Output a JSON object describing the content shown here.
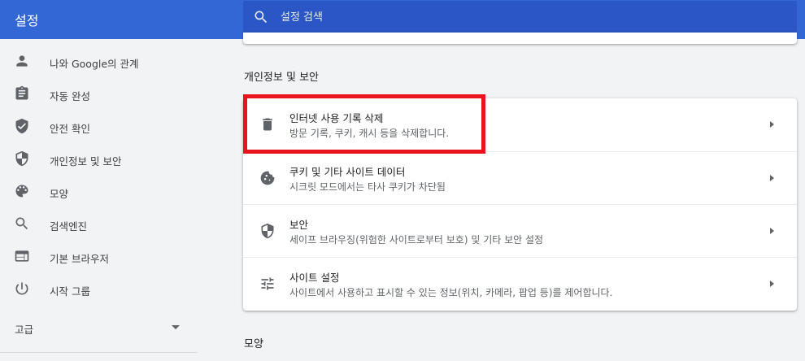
{
  "header": {
    "title": "설정",
    "search_placeholder": "설정 검색",
    "search_value": ""
  },
  "sidebar": {
    "items": [
      {
        "label": "나와 Google의 관계",
        "icon": "person-icon"
      },
      {
        "label": "자동 완성",
        "icon": "clipboard-icon"
      },
      {
        "label": "안전 확인",
        "icon": "shield-check-icon"
      },
      {
        "label": "개인정보 및 보안",
        "icon": "shield-icon"
      },
      {
        "label": "모양",
        "icon": "palette-icon"
      },
      {
        "label": "검색엔진",
        "icon": "search-icon"
      },
      {
        "label": "기본 브라우저",
        "icon": "browser-icon"
      },
      {
        "label": "시작 그룹",
        "icon": "power-icon"
      }
    ],
    "advanced_label": "고급"
  },
  "main": {
    "section_privacy": "개인정보 및 보안",
    "rows": [
      {
        "title": "인터넷 사용 기록 삭제",
        "sub": "방문 기록, 쿠키, 캐시 등을 삭제합니다.",
        "icon": "trash-icon"
      },
      {
        "title": "쿠키 및 기타 사이트 데이터",
        "sub": "시크릿 모드에서는 타사 쿠키가 차단됨",
        "icon": "cookie-icon"
      },
      {
        "title": "보안",
        "sub": "세이프 브라우징(위험한 사이트로부터 보호) 및 기타 보안 설정",
        "icon": "shield-icon"
      },
      {
        "title": "사이트 설정",
        "sub": "사이트에서 사용하고 표시할 수 있는 정보(위치, 카메라, 팝업 등)를 제어합니다.",
        "icon": "tune-icon"
      }
    ],
    "section_appearance": "모양"
  },
  "colors": {
    "header_bg": "#3367d6",
    "search_bg": "#2a56c6",
    "highlight": "#e8131d"
  }
}
